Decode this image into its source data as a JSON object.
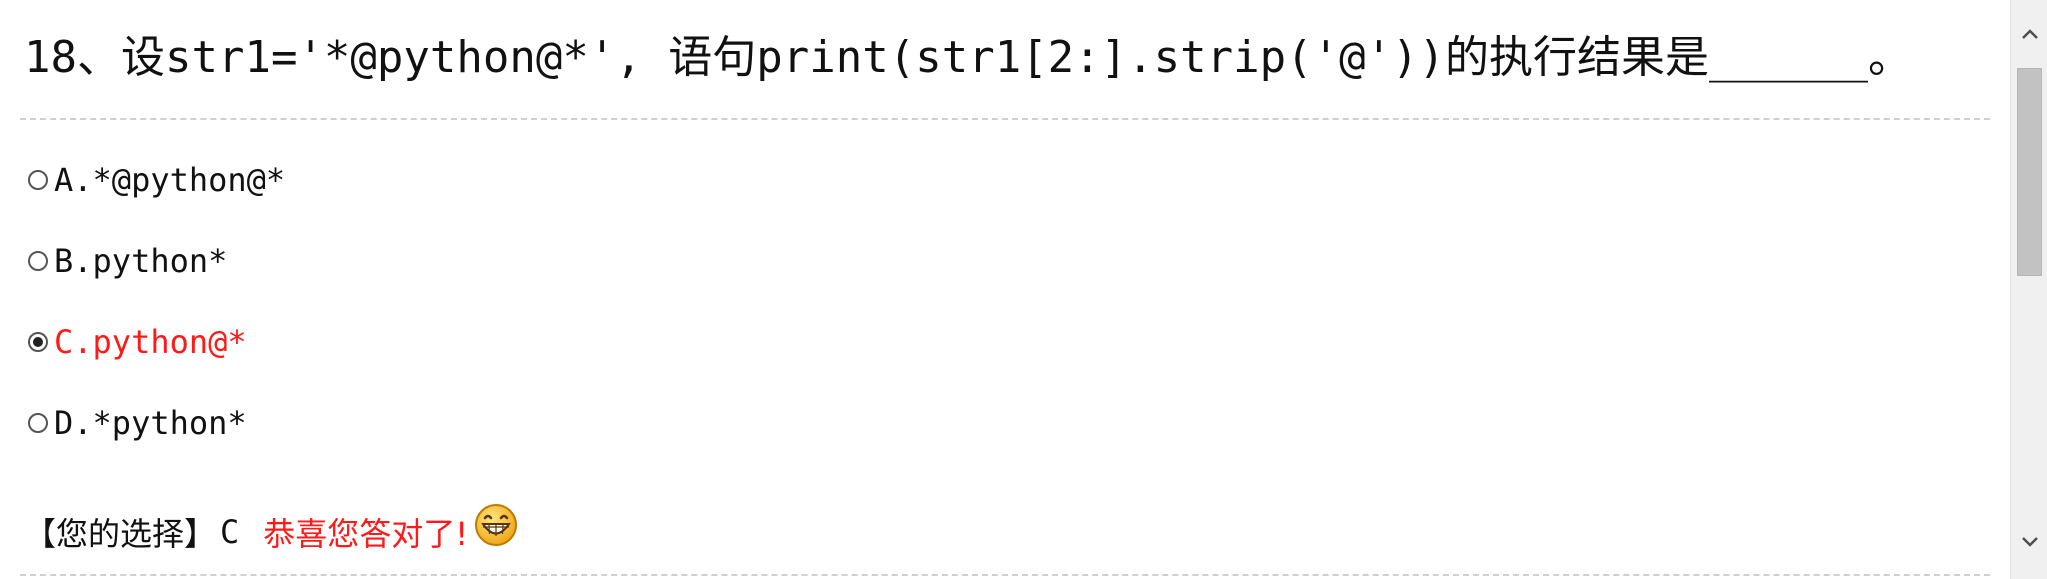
{
  "question": {
    "text": "18、设str1='*@python@*', 语句print(str1[2:].strip('@'))的执行结果是______。"
  },
  "options": [
    {
      "letter": "A.",
      "text": "*@python@*",
      "selected": false
    },
    {
      "letter": "B.",
      "text": "python*",
      "selected": false
    },
    {
      "letter": "C.",
      "text": "python@*",
      "selected": true
    },
    {
      "letter": "D.",
      "text": "*python*",
      "selected": false
    }
  ],
  "result": {
    "label": "【您的选择】",
    "choice": "C",
    "message": "恭喜您答对了!",
    "icon": "grinning-smiley-icon"
  },
  "colors": {
    "correct": "#ff1a1a",
    "text": "#111111",
    "divider": "#cfcfcf",
    "scrollbar_track": "#f0f0f0",
    "scrollbar_thumb": "#c2c2c2"
  }
}
